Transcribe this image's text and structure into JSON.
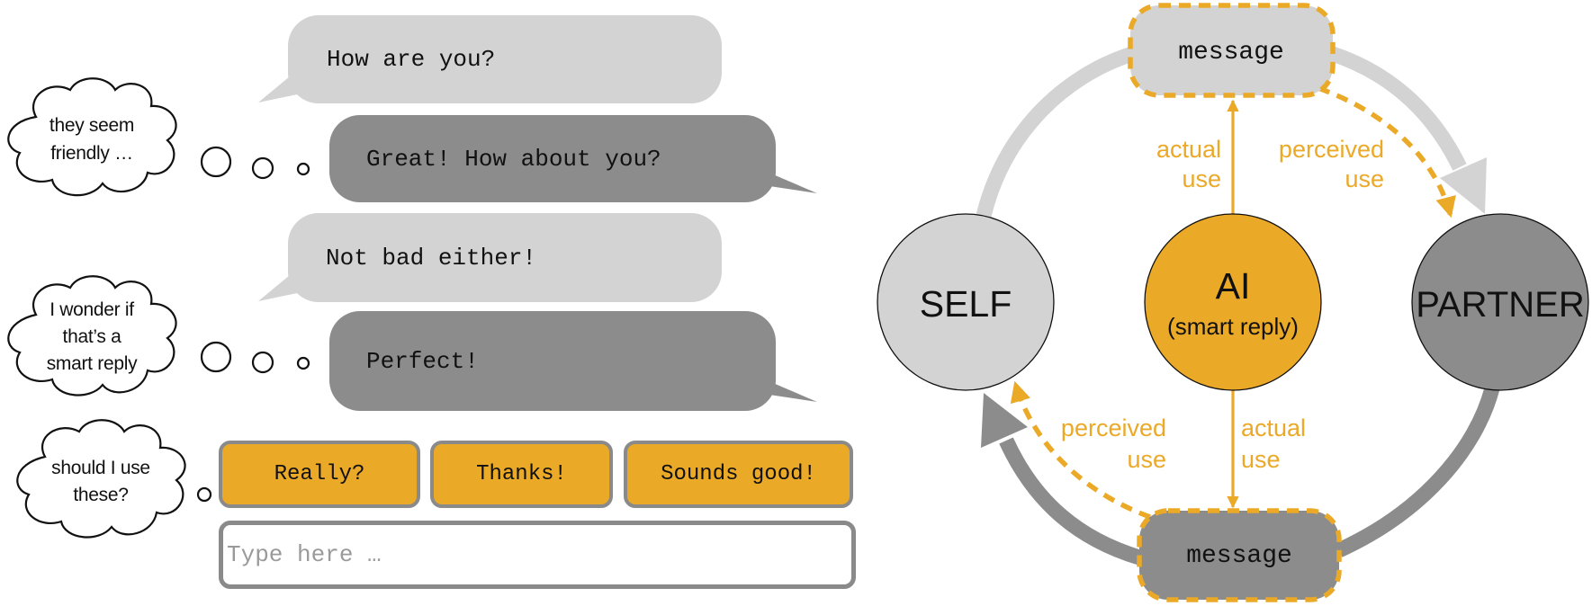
{
  "colors": {
    "accent_orange": "#eba928",
    "light_gray": "#d3d3d3",
    "dark_gray": "#8c8c8c",
    "chip_border": "#8a8a8a"
  },
  "chat": {
    "messages": [
      {
        "sender": "partner",
        "style": "light",
        "text": "How are you?"
      },
      {
        "sender": "self",
        "style": "dark",
        "text": "Great! How about you?"
      },
      {
        "sender": "partner",
        "style": "light",
        "text": "Not bad either!"
      },
      {
        "sender": "self",
        "style": "dark",
        "text": "Perfect!"
      }
    ],
    "thoughts": [
      {
        "lines": [
          "they seem",
          "friendly …"
        ]
      },
      {
        "lines": [
          "I wonder if",
          "that’s a",
          "smart reply"
        ]
      },
      {
        "lines": [
          "should I use",
          "these?"
        ]
      }
    ],
    "smart_replies": [
      "Really?",
      "Thanks!",
      "Sounds good!"
    ],
    "input": {
      "placeholder": "Type here …",
      "value": ""
    }
  },
  "diagram": {
    "nodes": {
      "self": {
        "label": "SELF"
      },
      "ai": {
        "label": "AI",
        "sublabel": "(smart reply)"
      },
      "partner": {
        "label": "PARTNER"
      }
    },
    "messages": {
      "top": {
        "label": "message"
      },
      "bottom": {
        "label": "message"
      }
    },
    "edge_labels": {
      "top_actual": [
        "actual",
        "use"
      ],
      "top_perceived": [
        "perceived",
        "use"
      ],
      "bottom_actual": [
        "actual",
        "use"
      ],
      "bottom_perceived": [
        "perceived",
        "use"
      ]
    }
  }
}
